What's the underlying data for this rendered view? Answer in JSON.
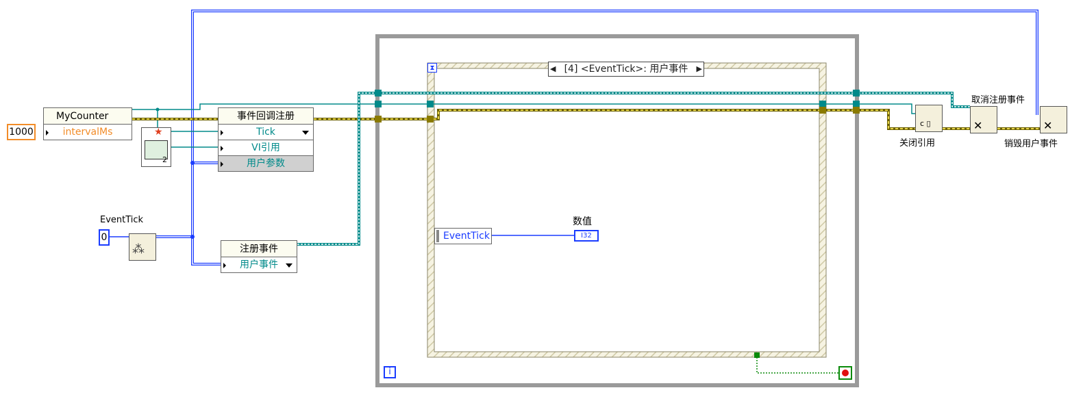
{
  "constants": {
    "interval_value": "1000",
    "event_tick_value": "0"
  },
  "labels": {
    "event_tick_control": "EventTick",
    "close_ref": "关闭引用",
    "unregister": "取消注册事件",
    "destroy": "销毁用户事件",
    "numeric": "数值"
  },
  "my_counter": {
    "title": "MyCounter",
    "property": "intervalMs"
  },
  "callback_reg": {
    "title": "事件回调注册",
    "rows": [
      "Tick",
      "VI引用",
      "用户参数"
    ]
  },
  "register": {
    "title": "注册事件",
    "row": "用户事件"
  },
  "event_case": {
    "selector": "[4] <EventTick>: 用户事件",
    "data_node_item": "EventTick"
  },
  "indicator": {
    "type_label": "I32"
  },
  "loop": {
    "iteration_label": "i"
  },
  "vi_ref_icon": {
    "number": "2"
  },
  "colors": {
    "refnum": "#008a8a",
    "event_wire": "#1a3cff",
    "cluster_wire": "#b5a000",
    "error_wire": "#6b6000",
    "orange_const": "#f28c28",
    "loop_frame": "#9a9a9a",
    "event_frame": "#d8d4b8"
  }
}
